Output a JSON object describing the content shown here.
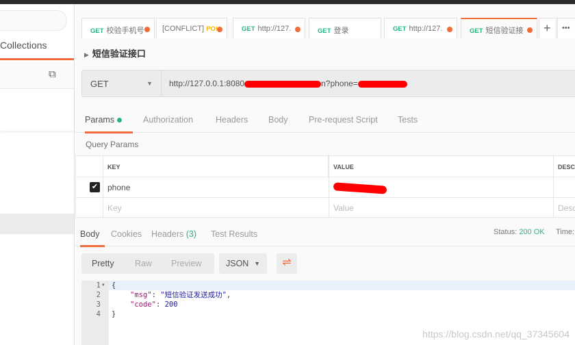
{
  "sidebar": {
    "collections_tab": "Collections",
    "new_collection_icon": "folder-plus-icon"
  },
  "tabs": [
    {
      "method": "GET",
      "label": "校验手机号",
      "unsaved": true
    },
    {
      "method": "",
      "label": "[CONFLICT]",
      "badge": "PO!",
      "unsaved": true
    },
    {
      "method": "GET",
      "label": "http://127.",
      "unsaved": true
    },
    {
      "method": "GET",
      "label": "登录",
      "unsaved": false
    },
    {
      "method": "GET",
      "label": "http://127.",
      "unsaved": true
    },
    {
      "method": "GET",
      "label": "短信验证接",
      "unsaved": true,
      "active": true
    }
  ],
  "tab_actions": {
    "add": "+",
    "more": "•••"
  },
  "request": {
    "title": "短信验证接口",
    "method": "GET",
    "url_prefix": "http://127.0.0.1:8080",
    "url_suffix": "n?phone="
  },
  "request_tabs": [
    "Params",
    "Authorization",
    "Headers",
    "Body",
    "Pre-request Script",
    "Tests"
  ],
  "params": {
    "section_title": "Query Params",
    "headers": [
      "KEY",
      "VALUE",
      "DESC"
    ],
    "rows": [
      {
        "key": "phone",
        "checked": true
      }
    ],
    "placeholders": {
      "key": "Key",
      "value": "Value",
      "desc": "Desc"
    }
  },
  "response": {
    "tabs": [
      "Body",
      "Cookies",
      "Headers",
      "(3)",
      "Test Results"
    ],
    "status_label": "Status:",
    "status_value": "200 OK",
    "time_label": "Time:",
    "view_modes": [
      "Pretty",
      "Raw",
      "Preview"
    ],
    "format": "JSON",
    "lines": [
      "1",
      "2",
      "3",
      "4"
    ],
    "code": {
      "open": "{",
      "msg_key": "\"msg\"",
      "msg_val": "\"短信验证发送成功\"",
      "code_key": "\"code\"",
      "code_val": "200",
      "close": "}"
    }
  },
  "watermark": "https://blog.csdn.net/qq_37345604",
  "colors": {
    "accent": "#f26b3a",
    "get": "#26b47f"
  }
}
